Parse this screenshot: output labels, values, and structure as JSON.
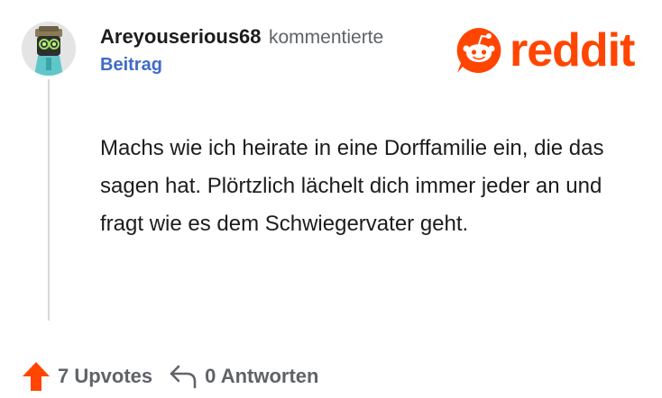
{
  "comment": {
    "username": "Areyouserious68",
    "verb": "kommentierte",
    "post_link": "Beitrag",
    "body": "Machs wie ich heirate in eine Dorffamilie ein, die das sagen hat. Plörtzlich lächelt dich immer jeder an und fragt wie es dem Schwiegervater geht."
  },
  "logo": {
    "wordmark": "reddit",
    "color": "#ff4500"
  },
  "footer": {
    "upvotes_label": "7 Upvotes",
    "replies_label": "0 Antworten",
    "upvote_icon": "upvote-arrow-icon",
    "reply_icon": "reply-arrow-icon",
    "upvote_color": "#ff4500"
  },
  "colors": {
    "link": "#3f6bc9",
    "muted": "#5f6368",
    "text": "#1c1c1c"
  }
}
